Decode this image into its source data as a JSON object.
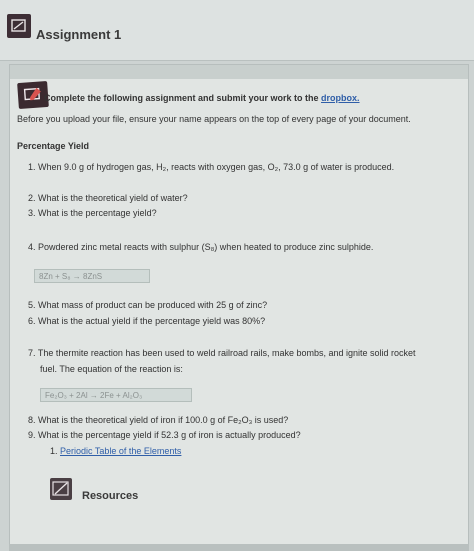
{
  "header": {
    "title": "Assignment 1"
  },
  "intro": {
    "instruction_prefix": "Complete the following assignment and submit your work to the ",
    "dropbox_link": "dropbox.",
    "note": "Before you upload your file, ensure your name appears on the top of every page of your document."
  },
  "section_title": "Percentage Yield",
  "questions": {
    "q1": "1. When 9.0 g of hydrogen gas, H₂, reacts with oxygen gas, O₂, 73.0 g of water is produced.",
    "q2": "2. What is the theoretical yield of water?",
    "q3": "3. What is the percentage yield?",
    "q4": "4. Powdered zinc metal reacts with sulphur (S₈) when heated to produce zinc sulphide.",
    "eq1": "8Zn  +  S₈  →  8ZnS",
    "q5": "5. What mass of product can be produced with 25 g of zinc?",
    "q6": "6. What is the actual yield if the percentage yield was 80%?",
    "q7_line1": "7. The thermite reaction has been used to weld railroad rails, make bombs, and ignite solid rocket",
    "q7_line2": "fuel. The equation of the reaction is:",
    "eq2": "Fe₂O₃  +  2Al  →  2Fe  +  Al₂O₃",
    "q8": "8. What is the theoretical yield of iron if 100.0 g of Fe₂O₃ is used?",
    "q9": "9. What is the percentage yield if 52.3 g of iron is actually produced?",
    "periodic_prefix": "1. ",
    "periodic_link": "Periodic Table of the Elements"
  },
  "resources": {
    "label": "Resources"
  },
  "colors": {
    "link": "#2f5ea8",
    "icon_dark": "#3b2a30",
    "panel_bg": "#e1e5e3"
  },
  "icons": {
    "assignment": "assignment-icon",
    "content": "content-icon",
    "resources": "resources-icon"
  }
}
